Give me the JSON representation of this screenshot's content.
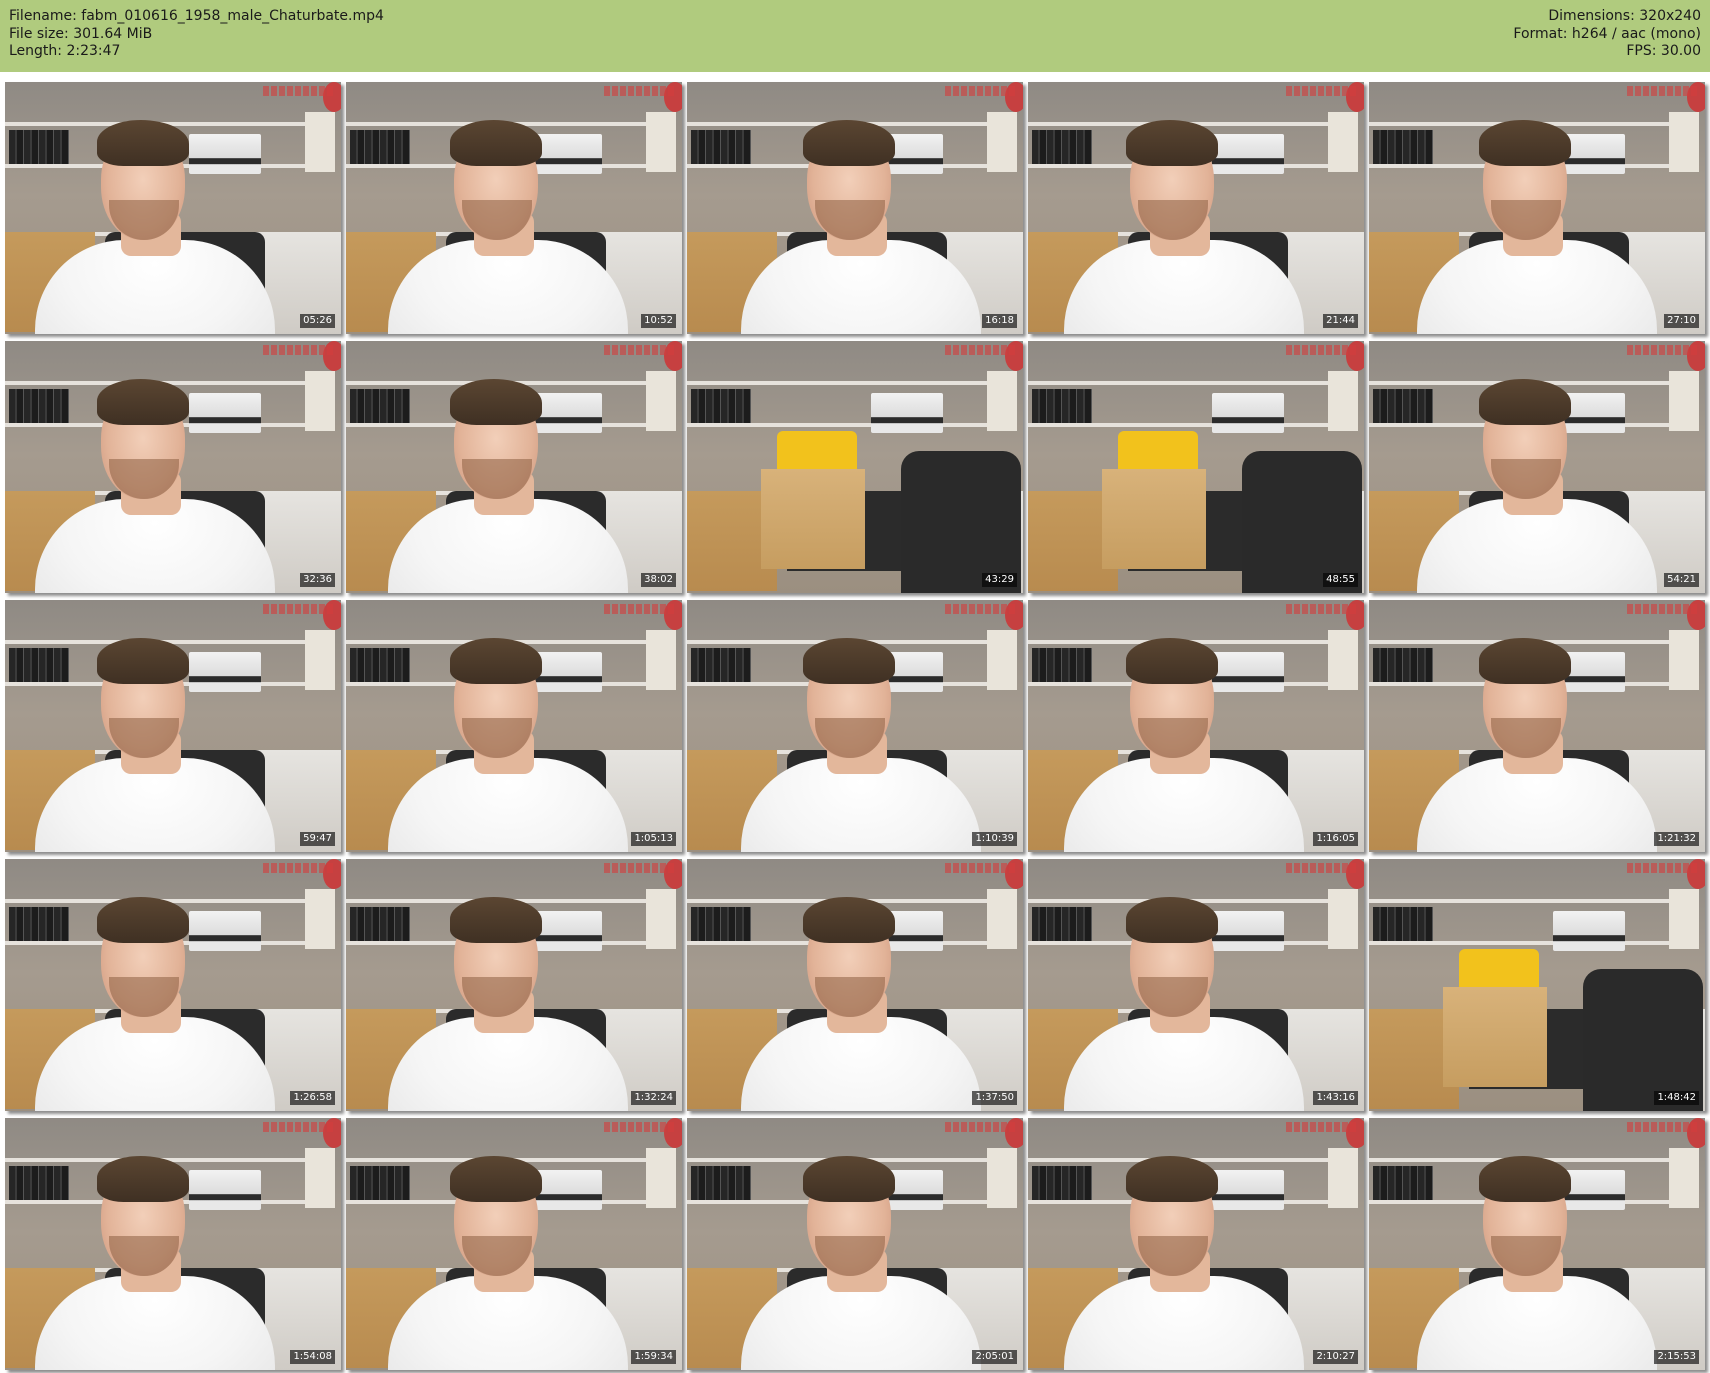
{
  "header": {
    "filename_label": "Filename: fabm_010616_1958_male_Chaturbate.mp4",
    "filesize_label": "File size: 301.64 MiB",
    "length_label": "Length: 2:23:47",
    "dimensions_label": "Dimensions: 320x240",
    "format_label": "Format: h264 / aac (mono)",
    "fps_label": "FPS: 30.00"
  },
  "colors": {
    "header_bg": "#b0cb7e",
    "timestamp_bg": "#000000"
  },
  "thumbnails": [
    {
      "time": "05:26",
      "scene": "person"
    },
    {
      "time": "10:52",
      "scene": "person"
    },
    {
      "time": "16:18",
      "scene": "person"
    },
    {
      "time": "21:44",
      "scene": "person"
    },
    {
      "time": "27:10",
      "scene": "person"
    },
    {
      "time": "32:36",
      "scene": "person"
    },
    {
      "time": "38:02",
      "scene": "person"
    },
    {
      "time": "43:29",
      "scene": "empty"
    },
    {
      "time": "48:55",
      "scene": "empty"
    },
    {
      "time": "54:21",
      "scene": "person"
    },
    {
      "time": "59:47",
      "scene": "person"
    },
    {
      "time": "1:05:13",
      "scene": "person"
    },
    {
      "time": "1:10:39",
      "scene": "person"
    },
    {
      "time": "1:16:05",
      "scene": "person"
    },
    {
      "time": "1:21:32",
      "scene": "person"
    },
    {
      "time": "1:26:58",
      "scene": "person"
    },
    {
      "time": "1:32:24",
      "scene": "person"
    },
    {
      "time": "1:37:50",
      "scene": "person"
    },
    {
      "time": "1:43:16",
      "scene": "person"
    },
    {
      "time": "1:48:42",
      "scene": "empty"
    },
    {
      "time": "1:54:08",
      "scene": "person"
    },
    {
      "time": "1:59:34",
      "scene": "person"
    },
    {
      "time": "2:05:01",
      "scene": "person"
    },
    {
      "time": "2:10:27",
      "scene": "person"
    },
    {
      "time": "2:15:53",
      "scene": "person"
    }
  ]
}
